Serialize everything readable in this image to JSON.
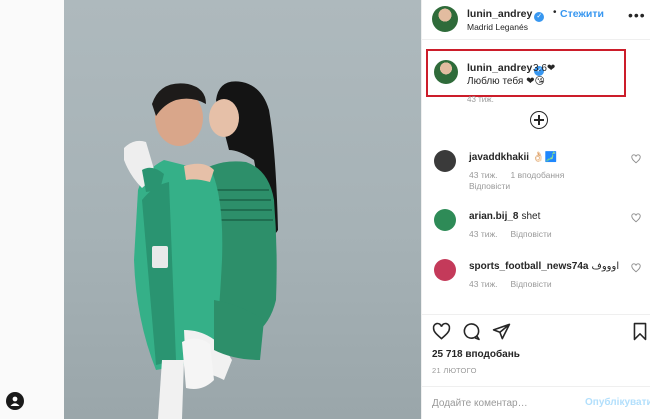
{
  "header": {
    "username": "lunin_andrey",
    "separator": "•",
    "follow_label": "Стежити",
    "location": "Madrid Leganés",
    "more_icon": "more-dots-icon"
  },
  "caption": {
    "username": "lunin_andrey",
    "text_line1": "3.6❤",
    "text_line2": "Люблю тебя ❤😘",
    "time": "43 тиж."
  },
  "comments": [
    {
      "username": "javaddkhakii",
      "text": "👌🏻🗾",
      "time": "43 тиж.",
      "likes": "1 вподобання",
      "reply_label": "Відповісти",
      "avatar_color": "#3a3a3a"
    },
    {
      "username": "arian.bij_8",
      "text": "shet",
      "time": "43 тиж.",
      "reply_label": "Відповісти",
      "avatar_color": "#2e8b57"
    },
    {
      "username": "sports_football_news74a",
      "text": "اوووف",
      "time": "43 тиж.",
      "reply_label": "Відповісти",
      "avatar_color": "#c43a5a"
    }
  ],
  "actions": {
    "like_icon": "heart-outline-icon",
    "comment_icon": "comment-bubble-icon",
    "share_icon": "paper-plane-icon",
    "save_icon": "bookmark-icon"
  },
  "likes_text": "25 718 вподобань",
  "date_text": "21 ЛЮТОГО",
  "add_comment": {
    "placeholder": "Додайте коментар…",
    "publish_label": "Опублікувати"
  },
  "colors": {
    "accent": "#3897f0",
    "highlight_border": "#cc1d2a",
    "jersey_green": "#2fa87e"
  }
}
